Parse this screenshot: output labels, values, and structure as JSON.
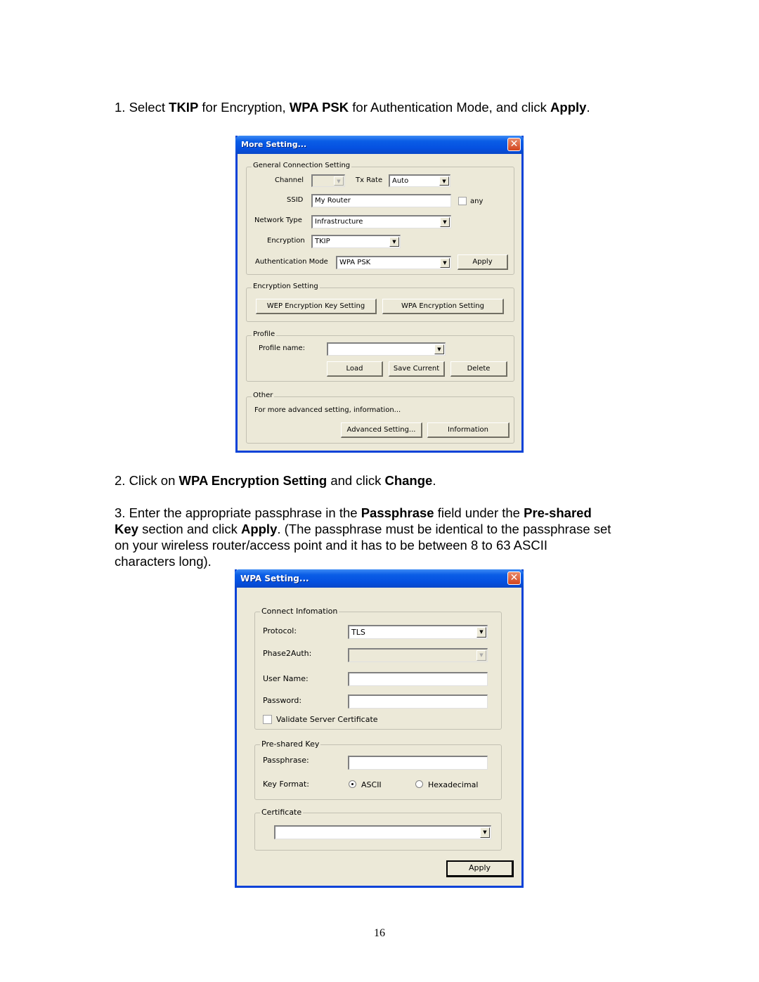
{
  "instructions": {
    "step1": {
      "p1": "1. Select ",
      "b1": "TKIP",
      "p2": " for Encryption, ",
      "b2": "WPA PSK",
      "p3": " for Authentication Mode, and click ",
      "b3": "Apply",
      "p4": "."
    },
    "step2": {
      "p1": "2. Click on ",
      "b1": "WPA Encryption Setting",
      "p2": " and click ",
      "b2": "Change",
      "p3": "."
    },
    "step3": {
      "p1": "3. Enter the appropriate passphrase in the ",
      "b1": "Passphrase",
      "p2": " field under the ",
      "b2": "Pre-shared",
      "l2b": "Key",
      "p3": " section and click ",
      "b3": "Apply",
      "p4": ". (The passphrase must be identical to the passphrase set",
      "l3": "on your wireless router/access point and it has to be between 8 to 63 ASCII",
      "l4": "characters long)."
    }
  },
  "more_setting_dialog": {
    "title": "More Setting...",
    "close_icon": "close-icon",
    "general": {
      "legend": "General Connection Setting",
      "channel_label": "Channel",
      "channel_value": "",
      "tx_rate_label": "Tx Rate",
      "tx_rate_value": "Auto",
      "ssid_label": "SSID",
      "ssid_value": "My Router",
      "any_label": "any",
      "any_checked": false,
      "network_type_label": "Network Type",
      "network_type_value": "Infrastructure",
      "encryption_label": "Encryption",
      "encryption_value": "TKIP",
      "auth_mode_label": "Authentication Mode",
      "auth_mode_value": "WPA PSK",
      "apply_button": "Apply"
    },
    "encryption": {
      "legend": "Encryption Setting",
      "wep_button": "WEP Encryption Key Setting",
      "wpa_button": "WPA Encryption Setting"
    },
    "profile": {
      "legend": "Profile",
      "name_label": "Profile name:",
      "name_value": "",
      "load_button": "Load",
      "save_button": "Save Current",
      "delete_button": "Delete"
    },
    "other": {
      "legend": "Other",
      "description": "For more advanced setting, information...",
      "advanced_button": "Advanced Setting...",
      "information_button": "Information"
    }
  },
  "wpa_setting_dialog": {
    "title": "WPA Setting...",
    "connect": {
      "legend": "Connect Infomation",
      "protocol_label": "Protocol:",
      "protocol_value": "TLS",
      "phase2_label": "Phase2Auth:",
      "phase2_value": "",
      "username_label": "User Name:",
      "username_value": "",
      "password_label": "Password:",
      "password_value": "",
      "validate_label": "Validate Server Certificate",
      "validate_checked": false
    },
    "psk": {
      "legend": "Pre-shared Key",
      "passphrase_label": "Passphrase:",
      "passphrase_value": "",
      "key_format_label": "Key Format:",
      "ascii_label": "ASCII",
      "hex_label": "Hexadecimal",
      "selected_format": "ASCII"
    },
    "certificate": {
      "legend": "Certificate",
      "value": ""
    },
    "apply_button": "Apply"
  },
  "page_number": "16"
}
